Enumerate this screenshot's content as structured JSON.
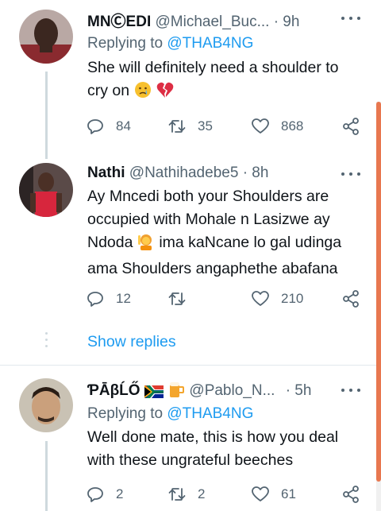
{
  "tweets": [
    {
      "name": "MNⒸEDI",
      "handle": "@Michael_Buc...",
      "time": "· 9h",
      "replying_prefix": "Replying to ",
      "replying_mention": "@THAB4NG",
      "text_line1": "She will definitely need a shoulder to",
      "text_line2": "cry on",
      "emojis": [
        "crying-face",
        "broken-heart"
      ],
      "replies": "84",
      "retweets": "35",
      "likes": "868"
    },
    {
      "name": "Nathi",
      "handle": "@Nathihadebe5",
      "time": "· 8h",
      "text_line1": "Ay Mncedi both your Shoulders are",
      "text_line2": "occupied with Mohale n Lasizwe ay",
      "text_line3a": "Ndoda",
      "text_line3b": "ima kaNcane lo gal udinga",
      "text_line4": "ama Shoulders angaphethe abafana",
      "emojis": [
        "person-raising-hand"
      ],
      "replies": "12",
      "retweets": "",
      "likes": "210",
      "show_replies": "Show replies"
    },
    {
      "name": "ƤĀβĹŐ",
      "handle": "@Pablo_N...",
      "time": "· 5h",
      "replying_prefix": "Replying to ",
      "replying_mention": "@THAB4NG",
      "text_line1": "Well done mate, this is how you deal",
      "text_line2": "with these ungrateful beeches",
      "emojis": [
        "south-africa-flag",
        "beer-mug"
      ],
      "replies": "2",
      "retweets": "2",
      "likes": "61"
    }
  ],
  "colors": {
    "accent": "#1d9bf0",
    "secondary_text": "#536471",
    "scroll_thumb": "#e8774f"
  }
}
